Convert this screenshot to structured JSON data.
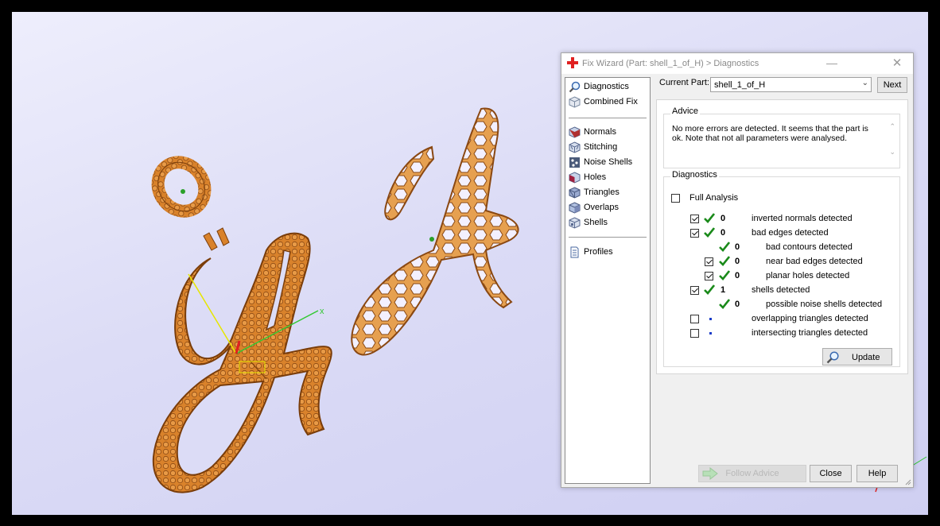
{
  "window": {
    "title": "Fix Wizard (Part: shell_1_of_H) > Diagnostics",
    "minimize_glyph": "—",
    "close_glyph": "✕"
  },
  "nav": {
    "items": [
      {
        "label": "Diagnostics",
        "icon": "magnifier-icon"
      },
      {
        "label": "Combined Fix",
        "icon": "cube-icon"
      },
      {
        "label": "Normals",
        "icon": "normals-cube-icon"
      },
      {
        "label": "Stitching",
        "icon": "stitching-cube-icon"
      },
      {
        "label": "Noise Shells",
        "icon": "noise-shells-icon"
      },
      {
        "label": "Holes",
        "icon": "holes-cube-icon"
      },
      {
        "label": "Triangles",
        "icon": "triangles-cube-icon"
      },
      {
        "label": "Overlaps",
        "icon": "overlaps-cube-icon"
      },
      {
        "label": "Shells",
        "icon": "shells-cube-icon"
      },
      {
        "label": "Profiles",
        "icon": "document-icon"
      }
    ]
  },
  "part": {
    "label": "Current Part:",
    "value": "shell_1_of_H",
    "next_label": "Next"
  },
  "advice": {
    "legend": "Advice",
    "text": "No more errors are detected. It seems that the part is ok. Note that not all parameters were analysed."
  },
  "diagnostics": {
    "legend": "Diagnostics",
    "full_analysis_label": "Full Analysis",
    "full_analysis_checked": false,
    "rows": [
      {
        "checkbox": "checked",
        "status": "ok",
        "count": "0",
        "label": "inverted normals detected",
        "indent": 0
      },
      {
        "checkbox": "checked",
        "status": "ok",
        "count": "0",
        "label": "bad edges detected",
        "indent": 0
      },
      {
        "checkbox": "none",
        "status": "ok",
        "count": "0",
        "label": "bad contours detected",
        "indent": 1
      },
      {
        "checkbox": "checked",
        "status": "ok",
        "count": "0",
        "label": "near bad edges detected",
        "indent": 1
      },
      {
        "checkbox": "checked",
        "status": "ok",
        "count": "0",
        "label": "planar holes detected",
        "indent": 1
      },
      {
        "checkbox": "checked",
        "status": "ok",
        "count": "1",
        "label": "shells detected",
        "indent": 0
      },
      {
        "checkbox": "none",
        "status": "ok",
        "count": "0",
        "label": "possible noise shells detected",
        "indent": 1
      },
      {
        "checkbox": "unchecked",
        "status": "pending",
        "count": "",
        "label": "overlapping triangles detected",
        "indent": 0
      },
      {
        "checkbox": "unchecked",
        "status": "pending",
        "count": "",
        "label": "intersecting triangles detected",
        "indent": 0
      }
    ],
    "update_label": "Update"
  },
  "buttons": {
    "follow_advice": "Follow Advice",
    "close": "Close",
    "help": "Help"
  },
  "viewport": {
    "axis_label": "x",
    "colors": {
      "part": "#d9822b",
      "part_outline": "#7a3d0a",
      "background": "#dcdcf6",
      "axis_x": "#32c832",
      "axis_y": "#e6e600",
      "axis_z": "#e02020"
    }
  },
  "colors": {
    "ok_check": "#1a8a1a",
    "pending_dot": "#1a3cc8",
    "title_icon": "#e02020"
  }
}
